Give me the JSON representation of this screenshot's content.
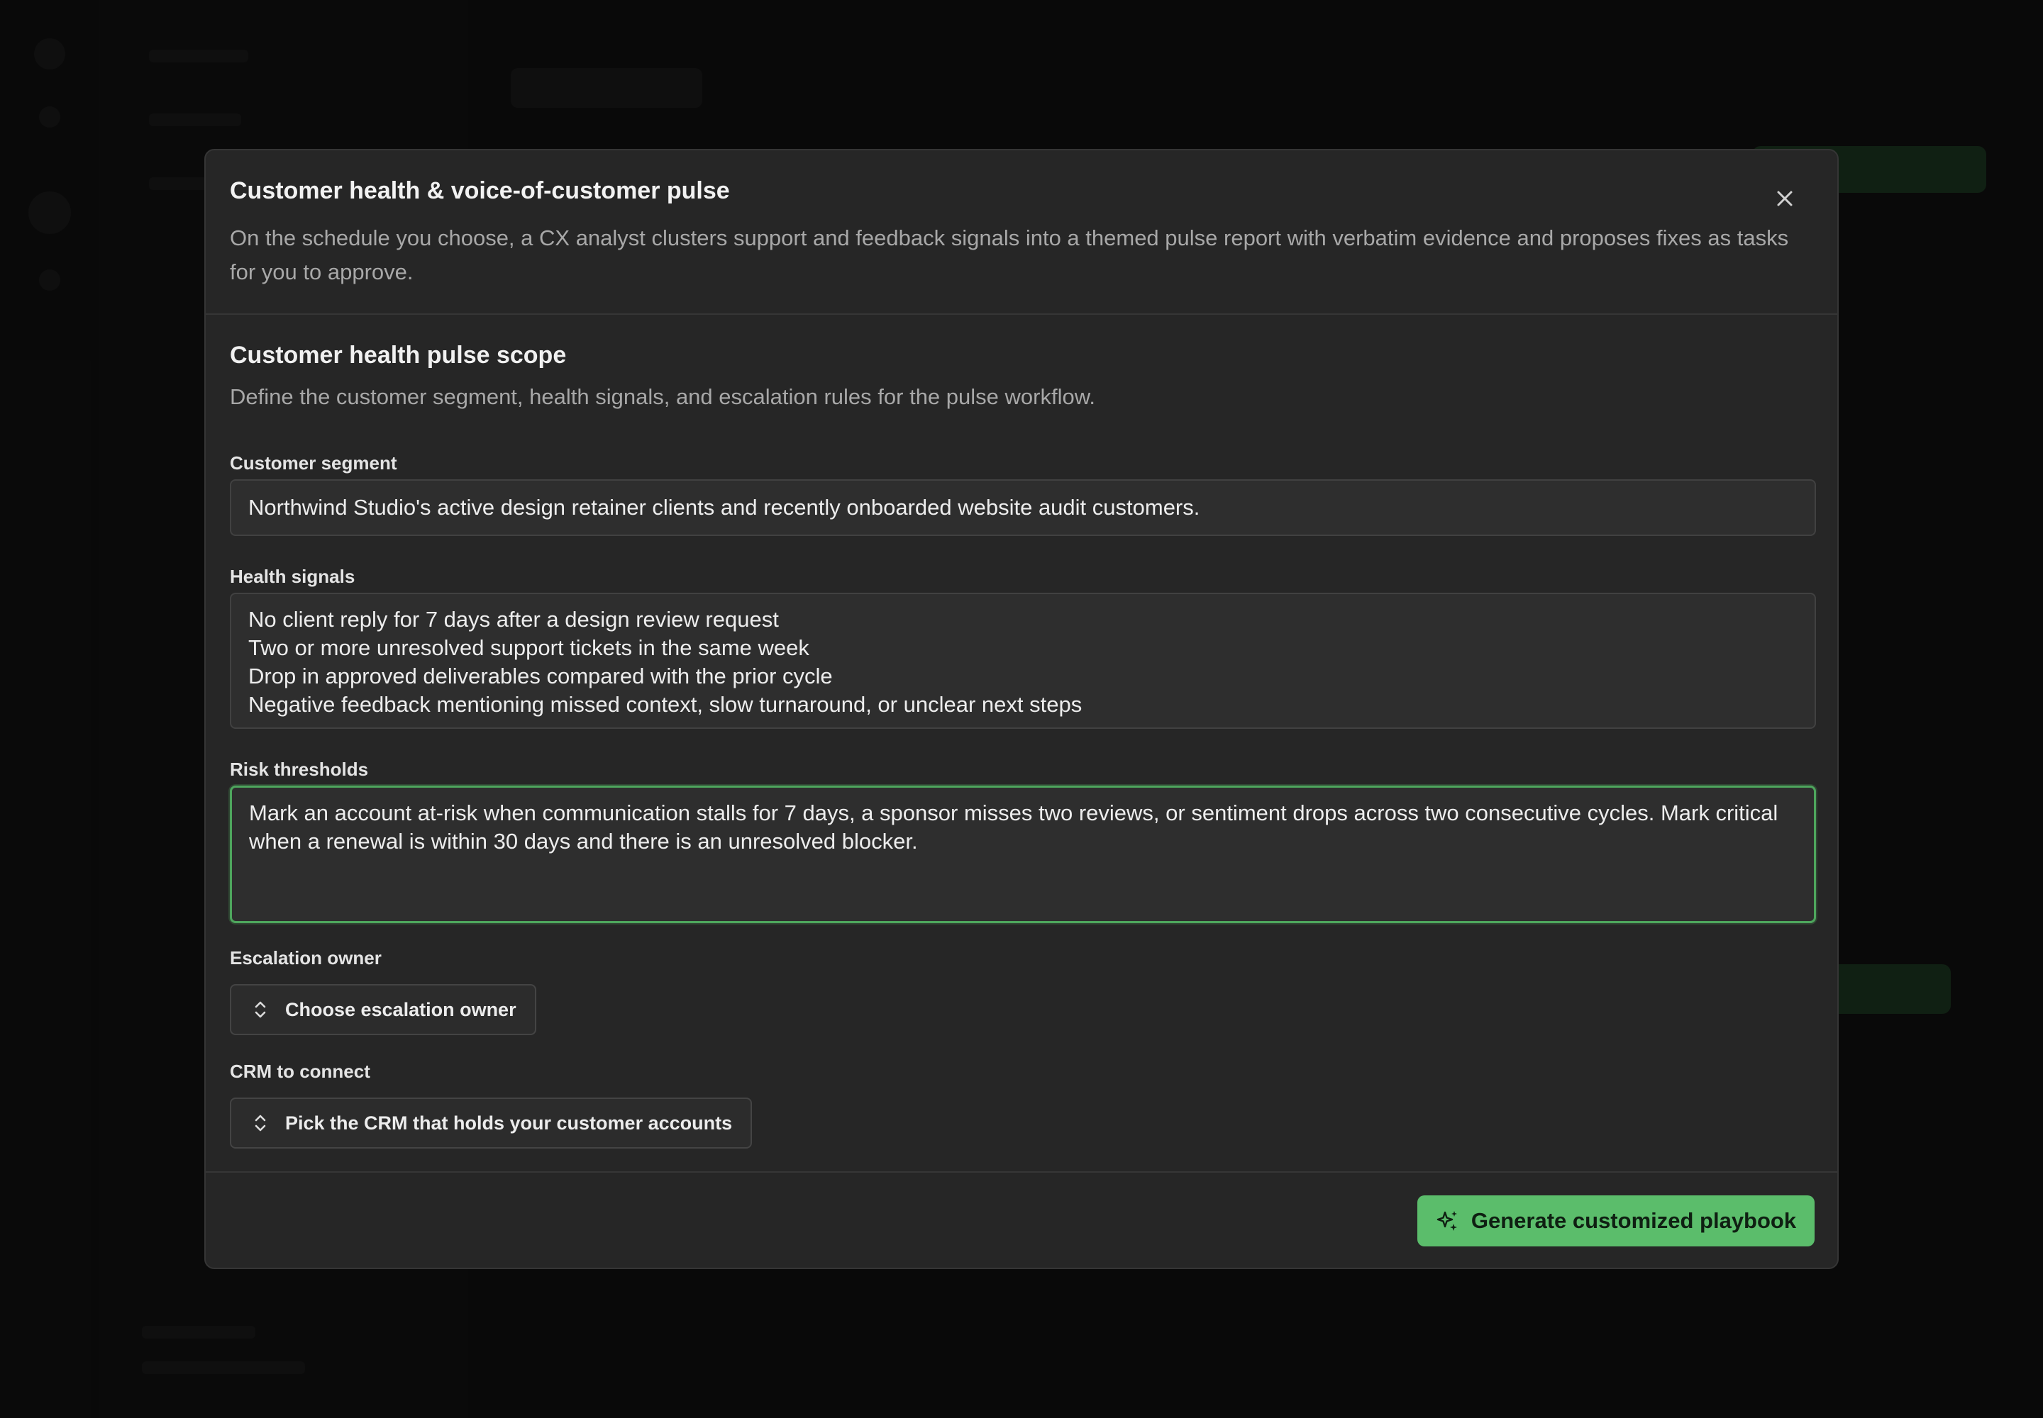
{
  "modal": {
    "title": "Customer health & voice-of-customer pulse",
    "description": "On the schedule you choose, a CX analyst clusters support and feedback signals into a themed pulse report with verbatim evidence and proposes fixes as tasks for you to approve.",
    "close_icon": "close-icon"
  },
  "section": {
    "title": "Customer health pulse scope",
    "description": "Define the customer segment, health signals, and escalation rules for the pulse workflow."
  },
  "fields": {
    "customer_segment": {
      "label": "Customer segment",
      "value": "Northwind Studio's active design retainer clients and recently onboarded website audit customers."
    },
    "health_signals": {
      "label": "Health signals",
      "lines": [
        "No client reply for 7 days after a design review request",
        "Two or more unresolved support tickets in the same week",
        "Drop in approved deliverables compared with the prior cycle",
        "Negative feedback mentioning missed context, slow turnaround, or unclear next steps"
      ]
    },
    "risk_thresholds": {
      "label": "Risk thresholds",
      "value": "Mark an account at-risk when communication stalls for 7 days, a sponsor misses two reviews, or sentiment drops across two consecutive cycles. Mark critical when a renewal is within 30 days and there is an unresolved blocker."
    },
    "escalation_owner": {
      "label": "Escalation owner",
      "placeholder": "Choose escalation owner",
      "icon": "chevron-up-down-icon"
    },
    "crm": {
      "label": "CRM to connect",
      "placeholder": "Pick the CRM that holds your customer accounts",
      "icon": "chevron-up-down-icon"
    }
  },
  "footer": {
    "primary_label": "Generate customized playbook",
    "primary_icon": "sparkle-icon"
  },
  "colors": {
    "accent": "#5bbd6b",
    "focus_border": "#4ea65d",
    "modal_bg": "#262626",
    "backdrop": "#0f0f0f"
  }
}
